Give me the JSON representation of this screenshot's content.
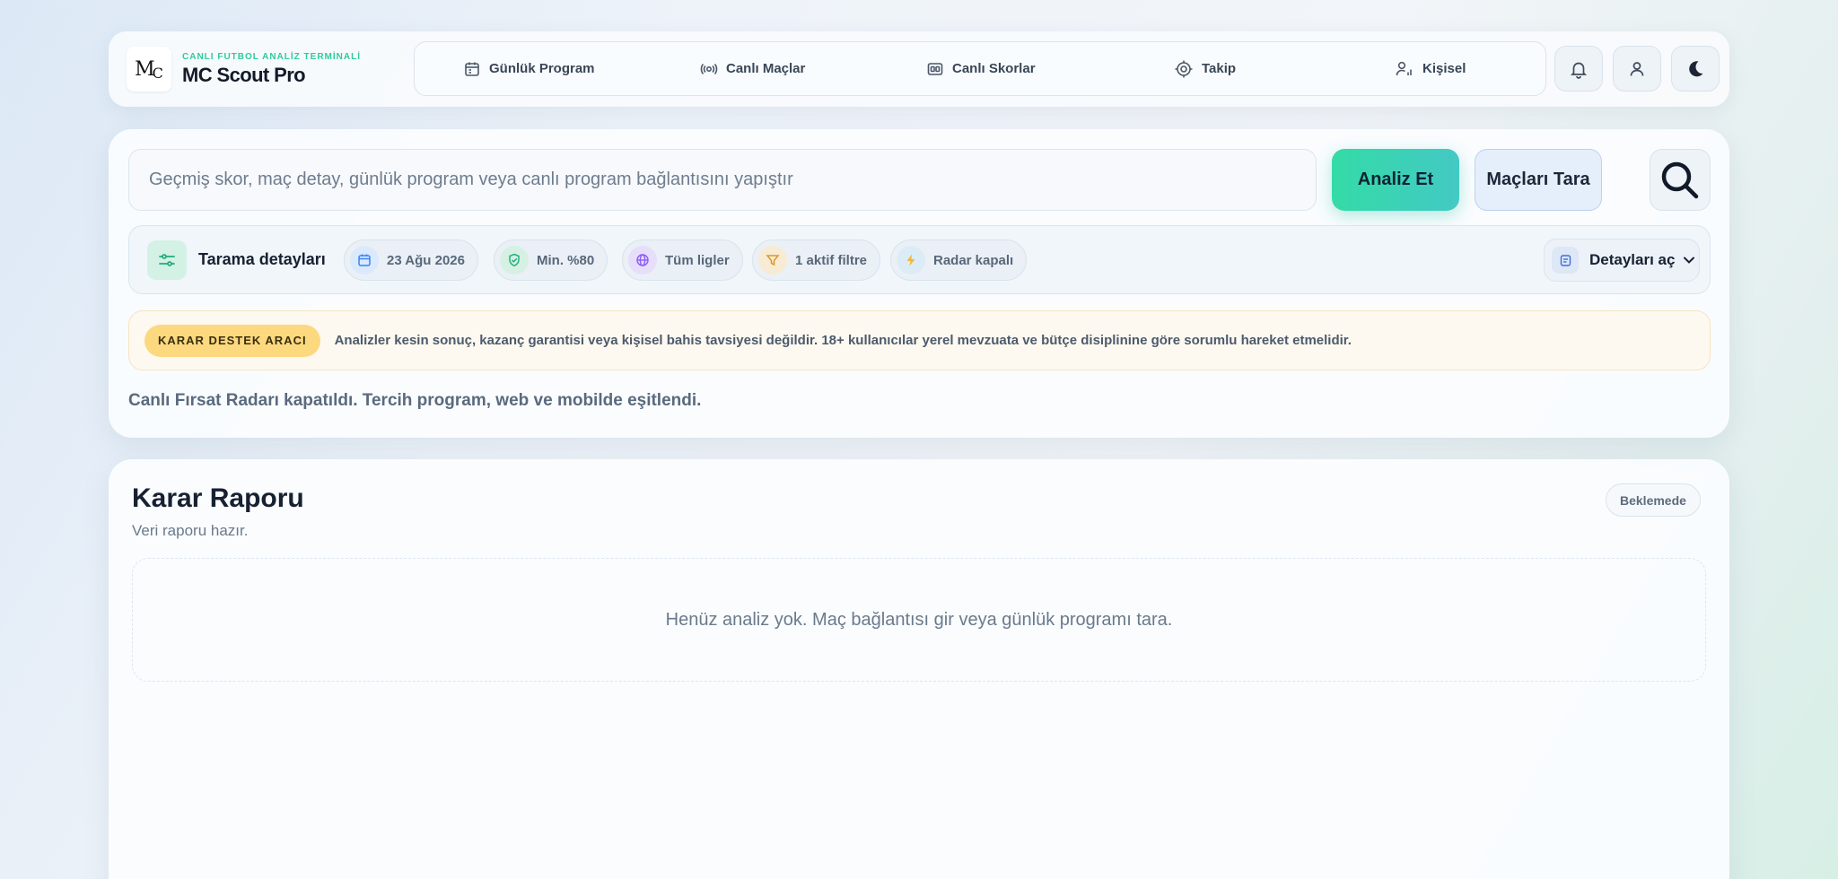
{
  "brand": {
    "logo_text": "MC",
    "subtitle": "CANLI FUTBOL ANALİZ TERMİNALİ",
    "title": "MC Scout Pro"
  },
  "nav": {
    "items": [
      {
        "label": "Günlük Program",
        "icon": "calendar-icon"
      },
      {
        "label": "Canlı Maçlar",
        "icon": "live-signal-icon"
      },
      {
        "label": "Canlı Skorlar",
        "icon": "scoreboard-icon"
      },
      {
        "label": "Takip",
        "icon": "target-icon"
      },
      {
        "label": "Kişisel",
        "icon": "user-stats-icon"
      }
    ]
  },
  "header_actions": [
    {
      "name": "notifications",
      "icon": "bell-icon"
    },
    {
      "name": "profile",
      "icon": "user-icon"
    },
    {
      "name": "theme",
      "icon": "moon-icon"
    }
  ],
  "search": {
    "placeholder": "Geçmiş skor, maç detay, günlük program veya canlı program bağlantısını yapıştır",
    "value": "",
    "analyze_label": "Analiz Et",
    "scan_label": "Maçları Tara"
  },
  "details": {
    "title": "Tarama detayları",
    "chips": [
      {
        "label": "23 Ağu 2026",
        "icon": "calendar-icon",
        "color": "#3b82f6"
      },
      {
        "label": "Min. %80",
        "icon": "shield-check-icon",
        "color": "#22b07d"
      },
      {
        "label": "Tüm ligler",
        "icon": "globe-icon",
        "color": "#8b5cf6"
      },
      {
        "label": "1 aktif filtre",
        "icon": "filter-icon",
        "color": "#d99a2b"
      },
      {
        "label": "Radar kapalı",
        "icon": "lightning-icon",
        "color": "#e8b63a"
      }
    ],
    "toggle_label": "Detayları aç"
  },
  "disclaimer": {
    "badge": "KARAR DESTEK ARACI",
    "text": "Analizler kesin sonuç, kazanç garantisi veya kişisel bahis tavsiyesi değildir. 18+ kullanıcılar yerel mevzuata ve bütçe disiplinine göre sorumlu hareket etmelidir."
  },
  "status_message": "Canlı Fırsat Radarı kapatıldı. Tercih program, web ve mobilde eşitlendi.",
  "report": {
    "title": "Karar Raporu",
    "subtitle": "Veri raporu hazır.",
    "status_badge": "Beklemede",
    "empty_text": "Henüz analiz yok. Maç bağlantısı gir veya günlük programı tara."
  },
  "colors": {
    "accent_green": "#34dba7",
    "accent_teal": "#43c9c4",
    "warning_badge": "#fcd97e",
    "scan_button_bg": "#e5eefb"
  }
}
